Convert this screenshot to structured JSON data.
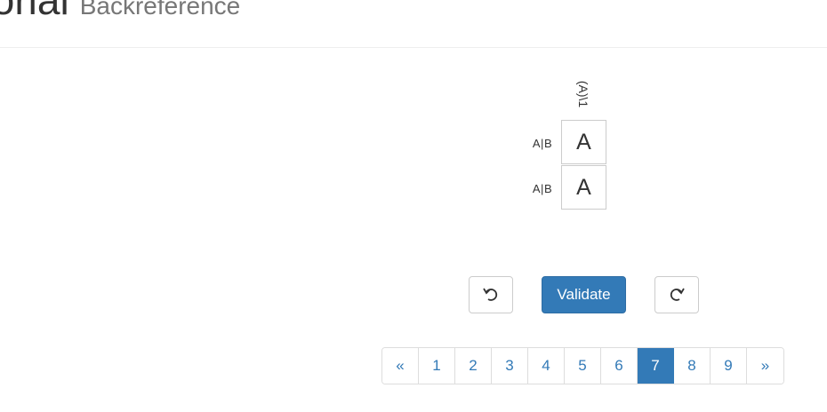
{
  "header": {
    "title": "torial",
    "subtitle": "Backreference"
  },
  "puzzle": {
    "column_clue": "(A)\\1",
    "rows": [
      {
        "clue": "A|B",
        "cell": "A"
      },
      {
        "clue": "A|B",
        "cell": "A"
      }
    ]
  },
  "controls": {
    "undo_icon": "undo-icon",
    "validate_label": "Validate",
    "redo_icon": "redo-icon",
    "primary_color": "#337ab7"
  },
  "pagination": {
    "prev_label": "«",
    "pages": [
      "1",
      "2",
      "3",
      "4",
      "5",
      "6",
      "7",
      "8",
      "9"
    ],
    "active_page": "7",
    "next_label": "»"
  }
}
